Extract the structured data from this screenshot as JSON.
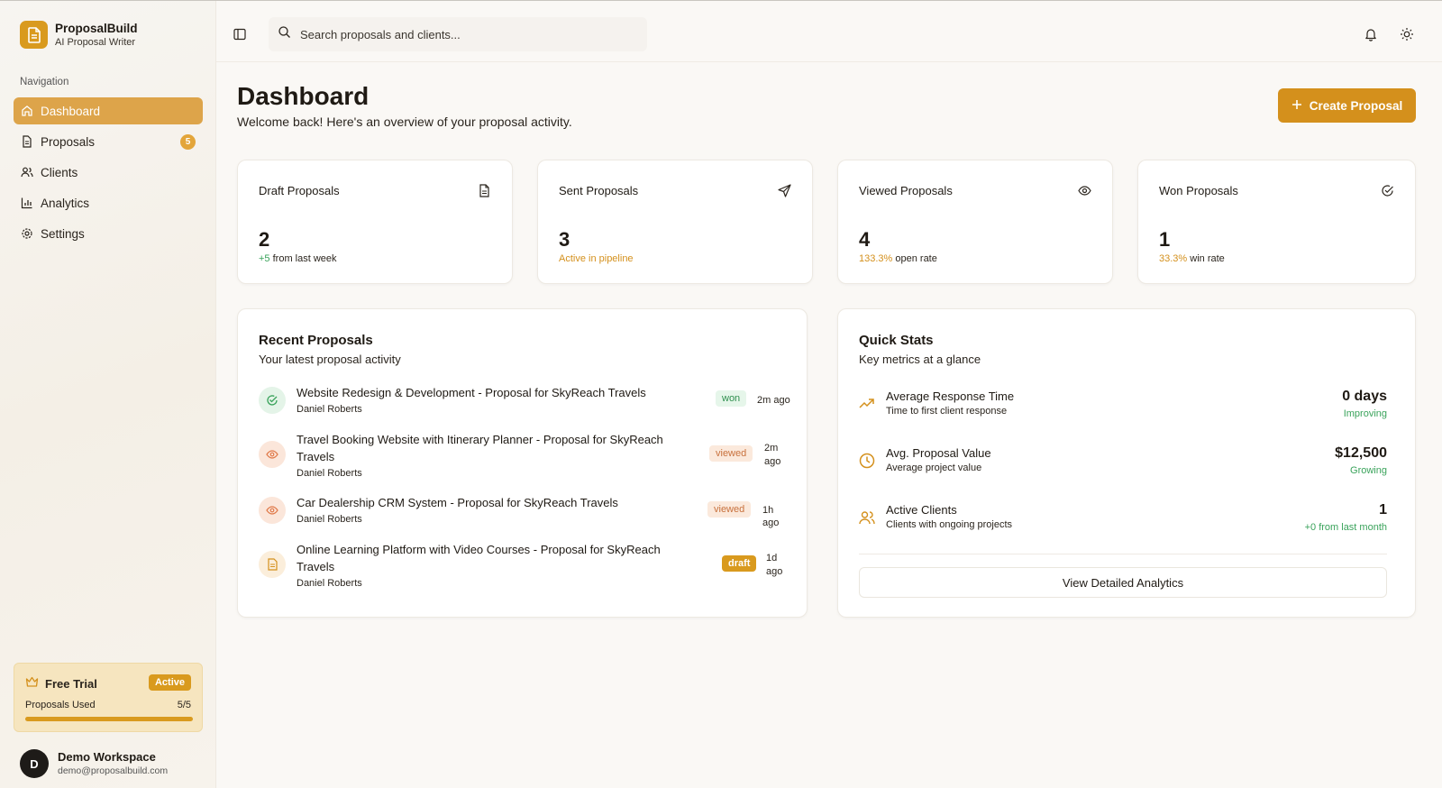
{
  "brand": {
    "name": "ProposalBuild",
    "tagline": "AI Proposal Writer"
  },
  "sidebar": {
    "heading": "Navigation",
    "items": [
      {
        "label": "Dashboard",
        "icon": "home-icon",
        "active": true
      },
      {
        "label": "Proposals",
        "icon": "document-icon",
        "badge": "5"
      },
      {
        "label": "Clients",
        "icon": "users-icon"
      },
      {
        "label": "Analytics",
        "icon": "bar-chart-icon"
      },
      {
        "label": "Settings",
        "icon": "gear-icon"
      }
    ],
    "trial": {
      "title": "Free Trial",
      "status": "Active",
      "used_label": "Proposals Used",
      "used_count": "5/5",
      "progress": 1.0
    },
    "workspace": {
      "initial": "D",
      "name": "Demo Workspace",
      "email": "demo@proposalbuild.com"
    }
  },
  "topbar": {
    "search_placeholder": "Search proposals and clients..."
  },
  "header": {
    "title": "Dashboard",
    "subtitle": "Welcome back! Here's an overview of your proposal activity.",
    "create_label": "Create Proposal"
  },
  "stats": [
    {
      "label": "Draft Proposals",
      "value": "2",
      "sub_highlight": "+5",
      "sub_text": "from last week",
      "icon": "document-icon"
    },
    {
      "label": "Sent Proposals",
      "value": "3",
      "sub_highlight": "Active in pipeline",
      "sub_text": "",
      "icon": "send-icon"
    },
    {
      "label": "Viewed Proposals",
      "value": "4",
      "sub_highlight": "133.3%",
      "sub_text": "open rate",
      "icon": "eye-icon"
    },
    {
      "label": "Won Proposals",
      "value": "1",
      "sub_highlight": "33.3%",
      "sub_text": "win rate",
      "icon": "check-circle-icon"
    }
  ],
  "recent": {
    "title": "Recent Proposals",
    "subtitle": "Your latest proposal activity",
    "items": [
      {
        "title": "Website Redesign & Development - Proposal for SkyReach Travels",
        "author": "Daniel Roberts",
        "status": "won",
        "time": "2m ago"
      },
      {
        "title_line1": "Travel Booking Website with Itinerary Planner - Proposal for SkyReach",
        "title_line2": "Travels",
        "author": "Daniel Roberts",
        "status": "viewed",
        "time_line1": "2m",
        "time_line2": "ago"
      },
      {
        "title": "Car Dealership CRM System - Proposal for SkyReach Travels",
        "author": "Daniel Roberts",
        "status": "viewed",
        "time": "1h ago"
      },
      {
        "title_line1": "Online Learning Platform with Video Courses - Proposal for SkyReach",
        "title_line2": "Travels",
        "author": "Daniel Roberts",
        "status": "draft",
        "time_line1": "1d",
        "time_line2": "ago"
      }
    ]
  },
  "quick_stats": {
    "title": "Quick Stats",
    "subtitle": "Key metrics at a glance",
    "items": [
      {
        "label": "Average Response Time",
        "desc": "Time to first client response",
        "value": "0 days",
        "trend": "Improving",
        "icon": "trending-up-icon"
      },
      {
        "label": "Avg. Proposal Value",
        "desc": "Average project value",
        "value": "$12,500",
        "trend": "Growing",
        "icon": "clock-icon"
      },
      {
        "label": "Active Clients",
        "desc": "Clients with ongoing projects",
        "value": "1",
        "trend": "+0 from last month",
        "icon": "users-icon"
      }
    ],
    "button_label": "View Detailed Analytics"
  },
  "colors": {
    "accent": "#d4901c",
    "success": "#3aa35b",
    "active_nav": "#dda44a"
  }
}
